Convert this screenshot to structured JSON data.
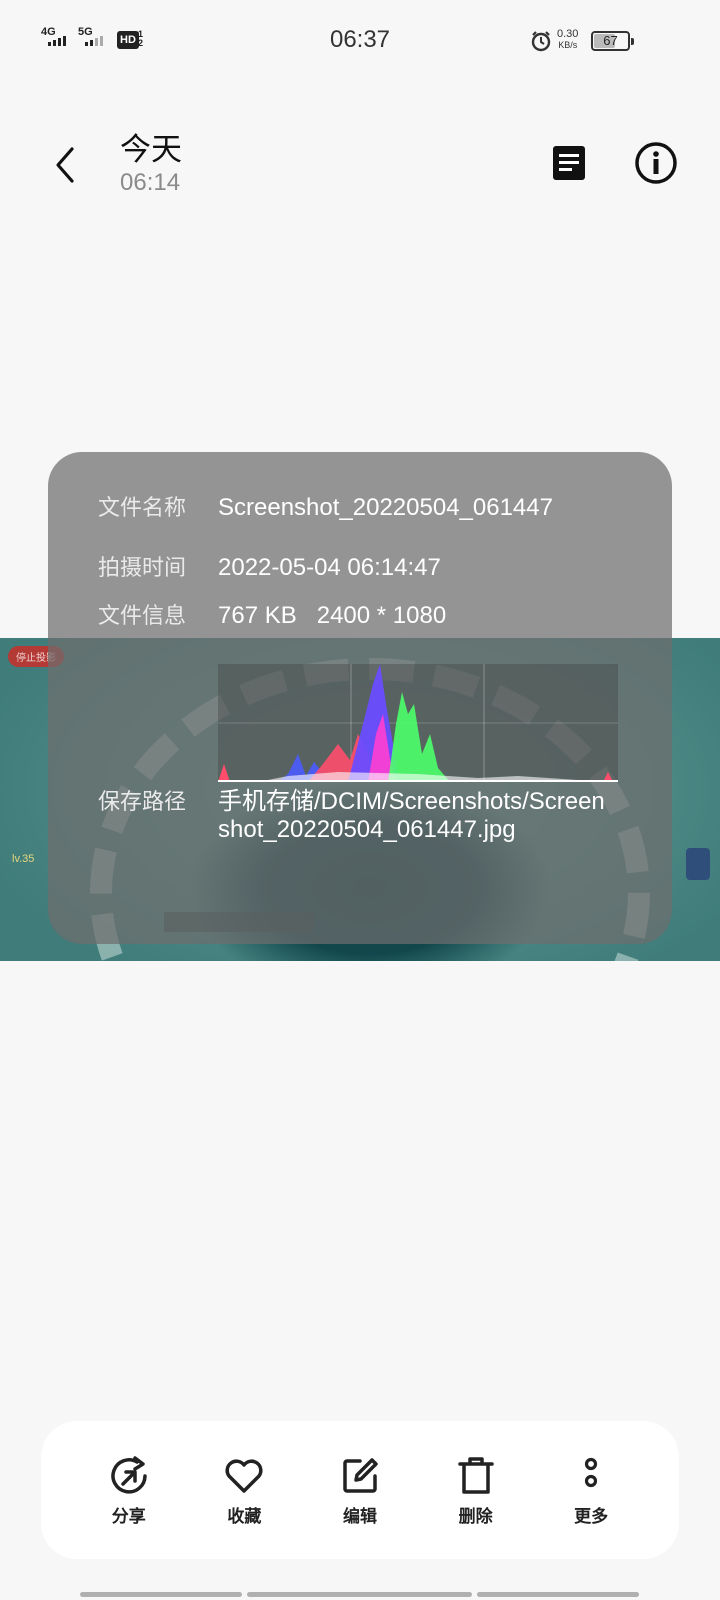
{
  "status_bar": {
    "net1": "4G",
    "net2": "5G",
    "hd": "HD",
    "hd_sub1": "1",
    "hd_sub2": "2",
    "time": "06:37",
    "net_speed": "0.30",
    "net_speed_unit": "KB/s",
    "battery": "67",
    "battery_level": 0.67
  },
  "header": {
    "title": "今天",
    "subtitle": "06:14"
  },
  "info": {
    "name_label": "文件名称",
    "name_value": "Screenshot_20220504_061447",
    "time_label": "拍摄时间",
    "time_value": "2022-05-04 06:14:47",
    "file_label": "文件信息",
    "file_value": "767 KB   2400 * 1080",
    "path_label": "保存路径",
    "path_value": "手机存储/DCIM/Screenshots/Screenshot_20220504_061447.jpg"
  },
  "screenshot": {
    "stop_label": "停止投影"
  },
  "toolbar": {
    "share": "分享",
    "favorite": "收藏",
    "edit": "编辑",
    "delete": "删除",
    "more": "更多"
  },
  "colors": {
    "background": "#f7f7f7",
    "panel": "#6e6e6e",
    "toolbar_bg": "#ffffff"
  }
}
